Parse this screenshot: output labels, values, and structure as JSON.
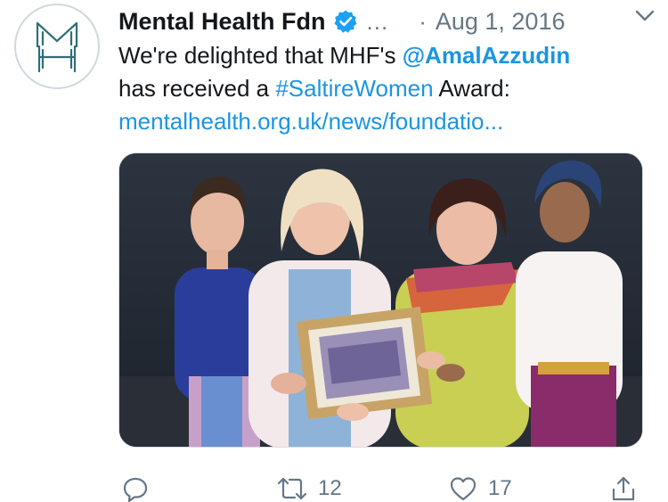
{
  "tweet": {
    "author_name": "Mental Health Fdn",
    "more_label": "...",
    "separator": "·",
    "date": "Aug 1, 2016",
    "text": {
      "line1_prefix": "We're delighted that MHF's ",
      "mention": "@AmalAzzudin",
      "line2_prefix": "has received a ",
      "hashtag": "#SaltireWomen",
      "line2_suffix": " Award:",
      "link": "mentalhealth.org.uk/news/foundatio..."
    },
    "actions": {
      "reply_count": "",
      "retweet_count": "12",
      "like_count": "17"
    }
  },
  "colors": {
    "link": "#1b95e0",
    "secondary": "#657786",
    "text": "#14171a",
    "avatar_logo": "#2f6f78"
  },
  "icons": [
    "logo-avatar",
    "verified-badge-icon",
    "chevron-down-icon",
    "reply-icon",
    "retweet-icon",
    "like-icon",
    "share-icon"
  ]
}
